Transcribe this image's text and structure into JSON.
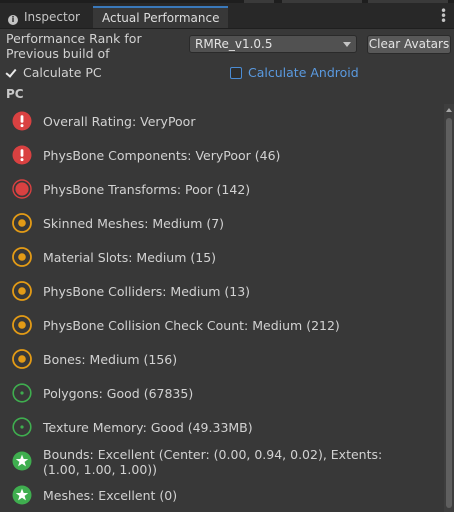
{
  "tabs": [
    {
      "label": "Inspector",
      "icon": "info-icon",
      "active": false
    },
    {
      "label": "Actual Performance",
      "active": true
    }
  ],
  "controls": {
    "perf_label": "Performance Rank for Previous build of",
    "build_select_value": "RMRe_v1.0.5",
    "clear_button_label": "Clear Avatars",
    "calc_pc_label": "Calculate PC",
    "calc_pc_checked": true,
    "calc_android_label": "Calculate Android",
    "calc_android_checked": false
  },
  "section_header": "PC",
  "ratings": [
    {
      "label": "Overall Rating: VeryPoor",
      "status": "verypoor"
    },
    {
      "label": "PhysBone Components: VeryPoor (46)",
      "status": "verypoor"
    },
    {
      "label": "PhysBone Transforms: Poor (142)",
      "status": "poor"
    },
    {
      "label": "Skinned Meshes: Medium (7)",
      "status": "medium"
    },
    {
      "label": "Material Slots: Medium (15)",
      "status": "medium"
    },
    {
      "label": "PhysBone Colliders: Medium (13)",
      "status": "medium"
    },
    {
      "label": "PhysBone Collision Check Count: Medium (212)",
      "status": "medium"
    },
    {
      "label": "Bones: Medium (156)",
      "status": "medium"
    },
    {
      "label": "Polygons: Good (67835)",
      "status": "good"
    },
    {
      "label": "Texture Memory: Good (49.33MB)",
      "status": "good"
    },
    {
      "label": "Bounds: Excellent (Center: (0.00, 0.94, 0.02), Extents: (1.00, 1.00, 1.00))",
      "status": "excellent"
    },
    {
      "label": "Meshes: Excellent (0)",
      "status": "excellent"
    }
  ],
  "colors": {
    "verypoor": "#d94141",
    "poor": "#d94141",
    "medium": "#e39b16",
    "good": "#3fae4f",
    "excellent": "#3fae4f",
    "accent": "#3a79bb"
  }
}
